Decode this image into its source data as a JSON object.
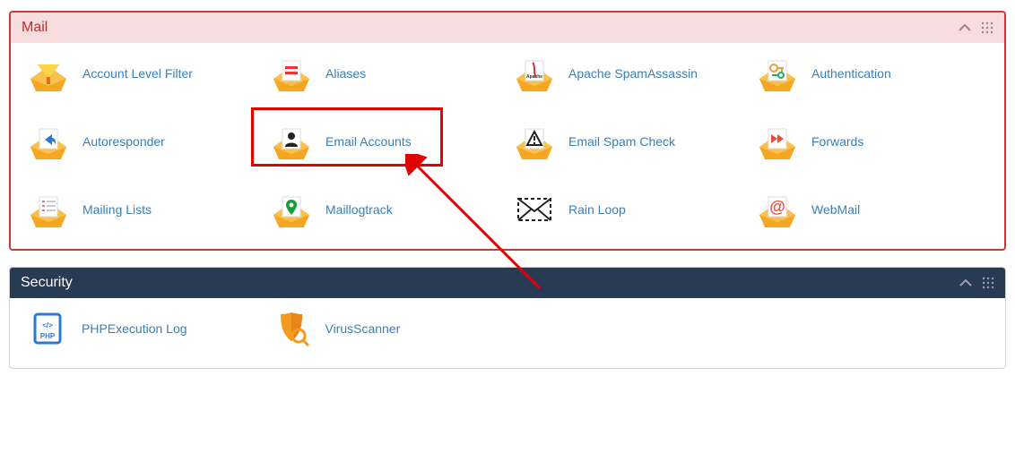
{
  "mail": {
    "title": "Mail",
    "items": [
      {
        "label": "Account Level Filter"
      },
      {
        "label": "Aliases"
      },
      {
        "label": "Apache SpamAssassin"
      },
      {
        "label": "Authentication"
      },
      {
        "label": "Autoresponder"
      },
      {
        "label": "Email Accounts"
      },
      {
        "label": "Email Spam Check"
      },
      {
        "label": "Forwards"
      },
      {
        "label": "Mailing Lists"
      },
      {
        "label": "Maillogtrack"
      },
      {
        "label": "Rain Loop"
      },
      {
        "label": "WebMail"
      }
    ]
  },
  "security": {
    "title": "Security",
    "items": [
      {
        "label": "PHPExecution Log"
      },
      {
        "label": "VirusScanner"
      }
    ]
  },
  "highlighted_item": "Email Accounts"
}
